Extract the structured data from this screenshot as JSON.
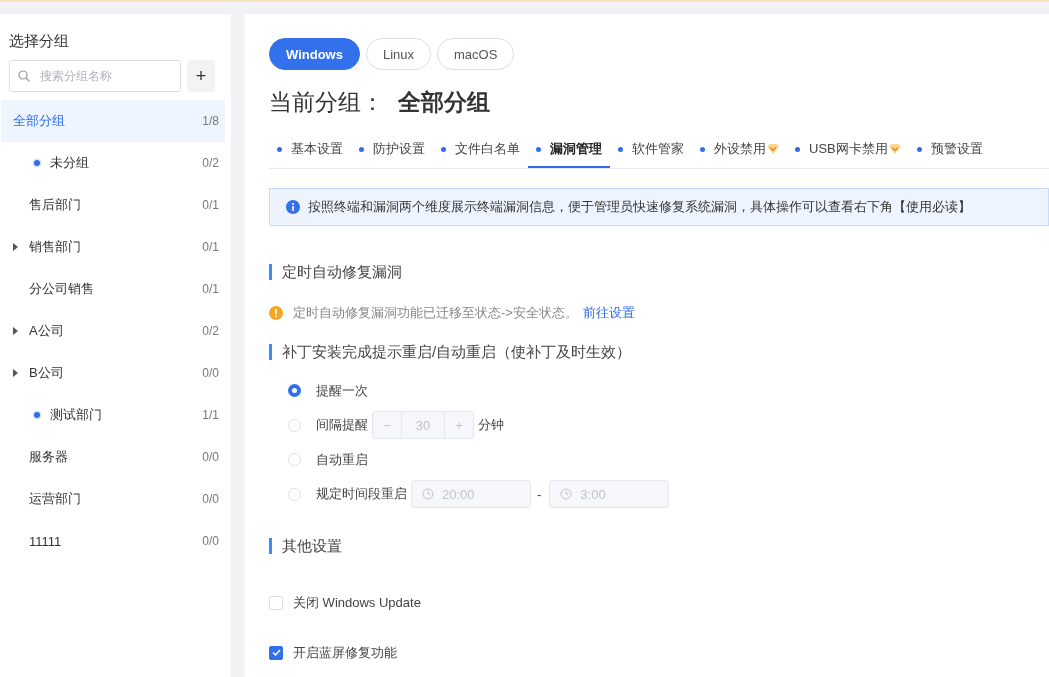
{
  "sidebar": {
    "title": "选择分组",
    "search": {
      "placeholder": "搜索分组名称"
    },
    "add_button": "+",
    "groups": [
      {
        "label": "全部分组",
        "count": "1/8",
        "selected": true,
        "children": [
          {
            "label": "未分组",
            "count": "0/2",
            "kind": "dot",
            "selected": false
          },
          {
            "label": "售后部门",
            "count": "0/1",
            "kind": "plain",
            "selected": false
          },
          {
            "label": "销售部门",
            "count": "0/1",
            "kind": "collapsed",
            "selected": false
          },
          {
            "label": "分公司销售",
            "count": "0/1",
            "kind": "plain",
            "selected": false
          },
          {
            "label": "A公司",
            "count": "0/2",
            "kind": "collapsed",
            "selected": false
          },
          {
            "label": "B公司",
            "count": "0/0",
            "kind": "collapsed",
            "selected": false
          },
          {
            "label": "测试部门",
            "count": "1/1",
            "kind": "dot",
            "selected": false
          },
          {
            "label": "服务器",
            "count": "0/0",
            "kind": "plain",
            "selected": false
          },
          {
            "label": "运营部门",
            "count": "0/0",
            "kind": "plain",
            "selected": false
          },
          {
            "label": "11111",
            "count": "0/0",
            "kind": "plain",
            "selected": false
          }
        ]
      }
    ]
  },
  "os_tabs": [
    {
      "label": "Windows",
      "selected": true
    },
    {
      "label": "Linux",
      "selected": false
    },
    {
      "label": "macOS",
      "selected": false
    }
  ],
  "current_group": {
    "label": "当前分组：",
    "value": "全部分组"
  },
  "tabs": [
    {
      "label": "基本设置",
      "selected": false,
      "premium": false
    },
    {
      "label": "防护设置",
      "selected": false,
      "premium": false
    },
    {
      "label": "文件白名单",
      "selected": false,
      "premium": false
    },
    {
      "label": "漏洞管理",
      "selected": true,
      "premium": false
    },
    {
      "label": "软件管家",
      "selected": false,
      "premium": false
    },
    {
      "label": "外设禁用",
      "selected": false,
      "premium": true
    },
    {
      "label": "USB网卡禁用",
      "selected": false,
      "premium": true
    },
    {
      "label": "预警设置",
      "selected": false,
      "premium": false
    }
  ],
  "info": "按照终端和漏洞两个维度展示终端漏洞信息，便于管理员快速修复系统漏洞，具体操作可以查看右下角【使用必读】",
  "sections": [
    {
      "title": "定时自动修复漏洞",
      "kind": "notice",
      "notice": {
        "text": "定时自动修复漏洞功能已迁移至状态->安全状态。",
        "link": "前往设置"
      }
    },
    {
      "title": "补丁安装完成提示重启/自动重启（使补丁及时生效）",
      "kind": "radios",
      "options": [
        {
          "label": "提醒一次",
          "kind": "plain",
          "selected": true
        },
        {
          "label": "间隔提醒",
          "kind": "stepper",
          "selected": false,
          "minus": "−",
          "value": "30",
          "plus": "+",
          "unit": "分钟"
        },
        {
          "label": "自动重启",
          "kind": "plain",
          "selected": false
        },
        {
          "label": "规定时间段重启",
          "kind": "timerange",
          "selected": false,
          "start": "20:00",
          "separator": "-",
          "end": "3:00"
        }
      ]
    },
    {
      "title": "其他设置",
      "kind": "checks",
      "options": [
        {
          "label": "关闭 Windows Update",
          "checked": false
        },
        {
          "label": "开启蓝屏修复功能",
          "checked": true
        }
      ]
    }
  ]
}
